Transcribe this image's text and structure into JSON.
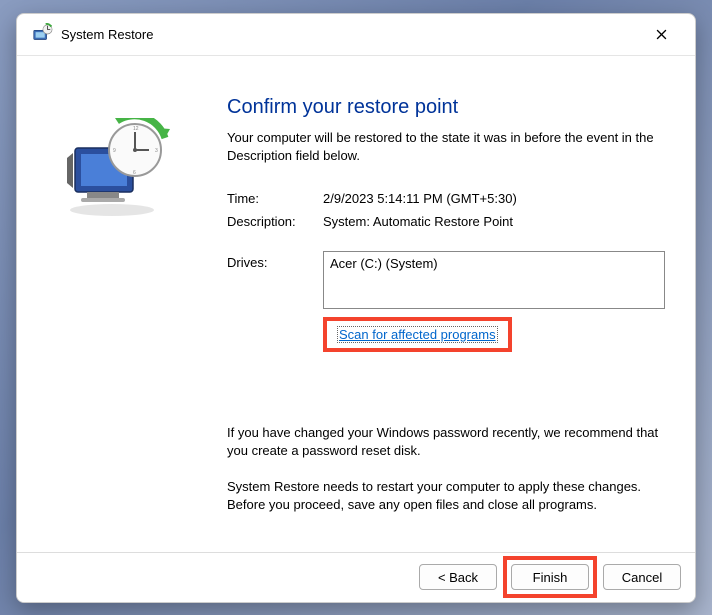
{
  "window": {
    "title": "System Restore"
  },
  "main": {
    "heading": "Confirm your restore point",
    "intro": "Your computer will be restored to the state it was in before the event in the Description field below.",
    "time_label": "Time:",
    "time_value": "2/9/2023 5:14:11 PM (GMT+5:30)",
    "description_label": "Description:",
    "description_value": "System: Automatic Restore Point",
    "drives_label": "Drives:",
    "drives_value": "Acer (C:) (System)",
    "scan_link": "Scan for affected programs",
    "password_note": "If you have changed your Windows password recently, we recommend that you create a password reset disk.",
    "restart_note": "System Restore needs to restart your computer to apply these changes. Before you proceed, save any open files and close all programs."
  },
  "footer": {
    "back": "< Back",
    "finish": "Finish",
    "cancel": "Cancel"
  }
}
